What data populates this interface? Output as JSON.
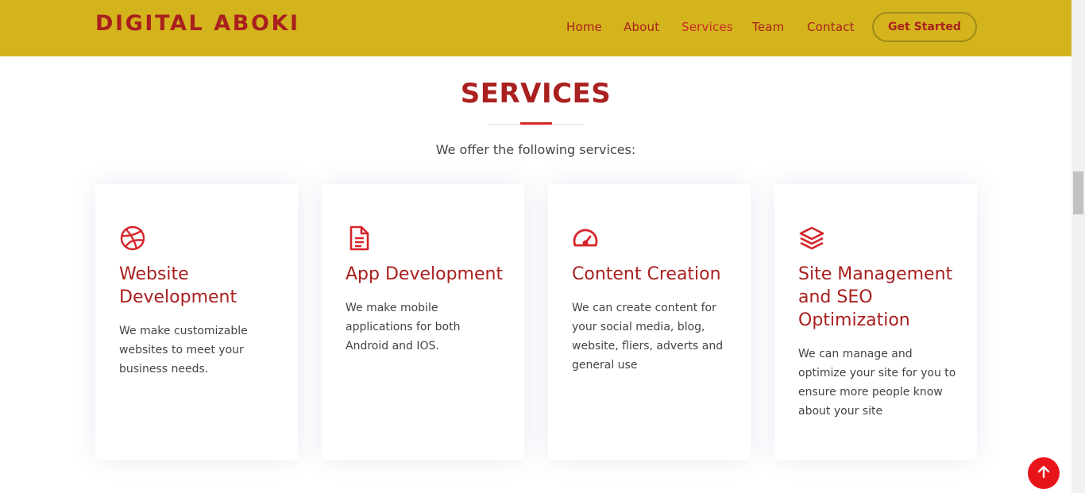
{
  "header": {
    "logo": "DIGITAL ABOKI",
    "nav": [
      {
        "label": "Home"
      },
      {
        "label": "About"
      },
      {
        "label": "Services"
      },
      {
        "label": "Team"
      },
      {
        "label": "Contact"
      }
    ],
    "active_nav": "Services",
    "cta_label": "Get Started"
  },
  "section": {
    "title": "SERVICES",
    "subtitle": "We offer the following services:"
  },
  "services": [
    {
      "icon": "dribbble-icon",
      "title": "Website Development",
      "desc": "We make customizable websites to meet your business needs."
    },
    {
      "icon": "document-icon",
      "title": "App Development",
      "desc": "We make mobile applications for both Android and IOS."
    },
    {
      "icon": "speedometer-icon",
      "title": "Content Creation",
      "desc": "We can create content for your social media, blog, website, fliers, adverts and general use"
    },
    {
      "icon": "layers-icon",
      "title": "Site Management and SEO Optimization",
      "desc": "We can manage and optimize your site for you to ensure more people know about your site"
    }
  ],
  "colors": {
    "header_bg": "#d3b41c",
    "brand_red": "#a9201f",
    "accent_red": "#e7141a",
    "text": "#444444"
  },
  "back_to_top_icon": "arrow-up-icon"
}
